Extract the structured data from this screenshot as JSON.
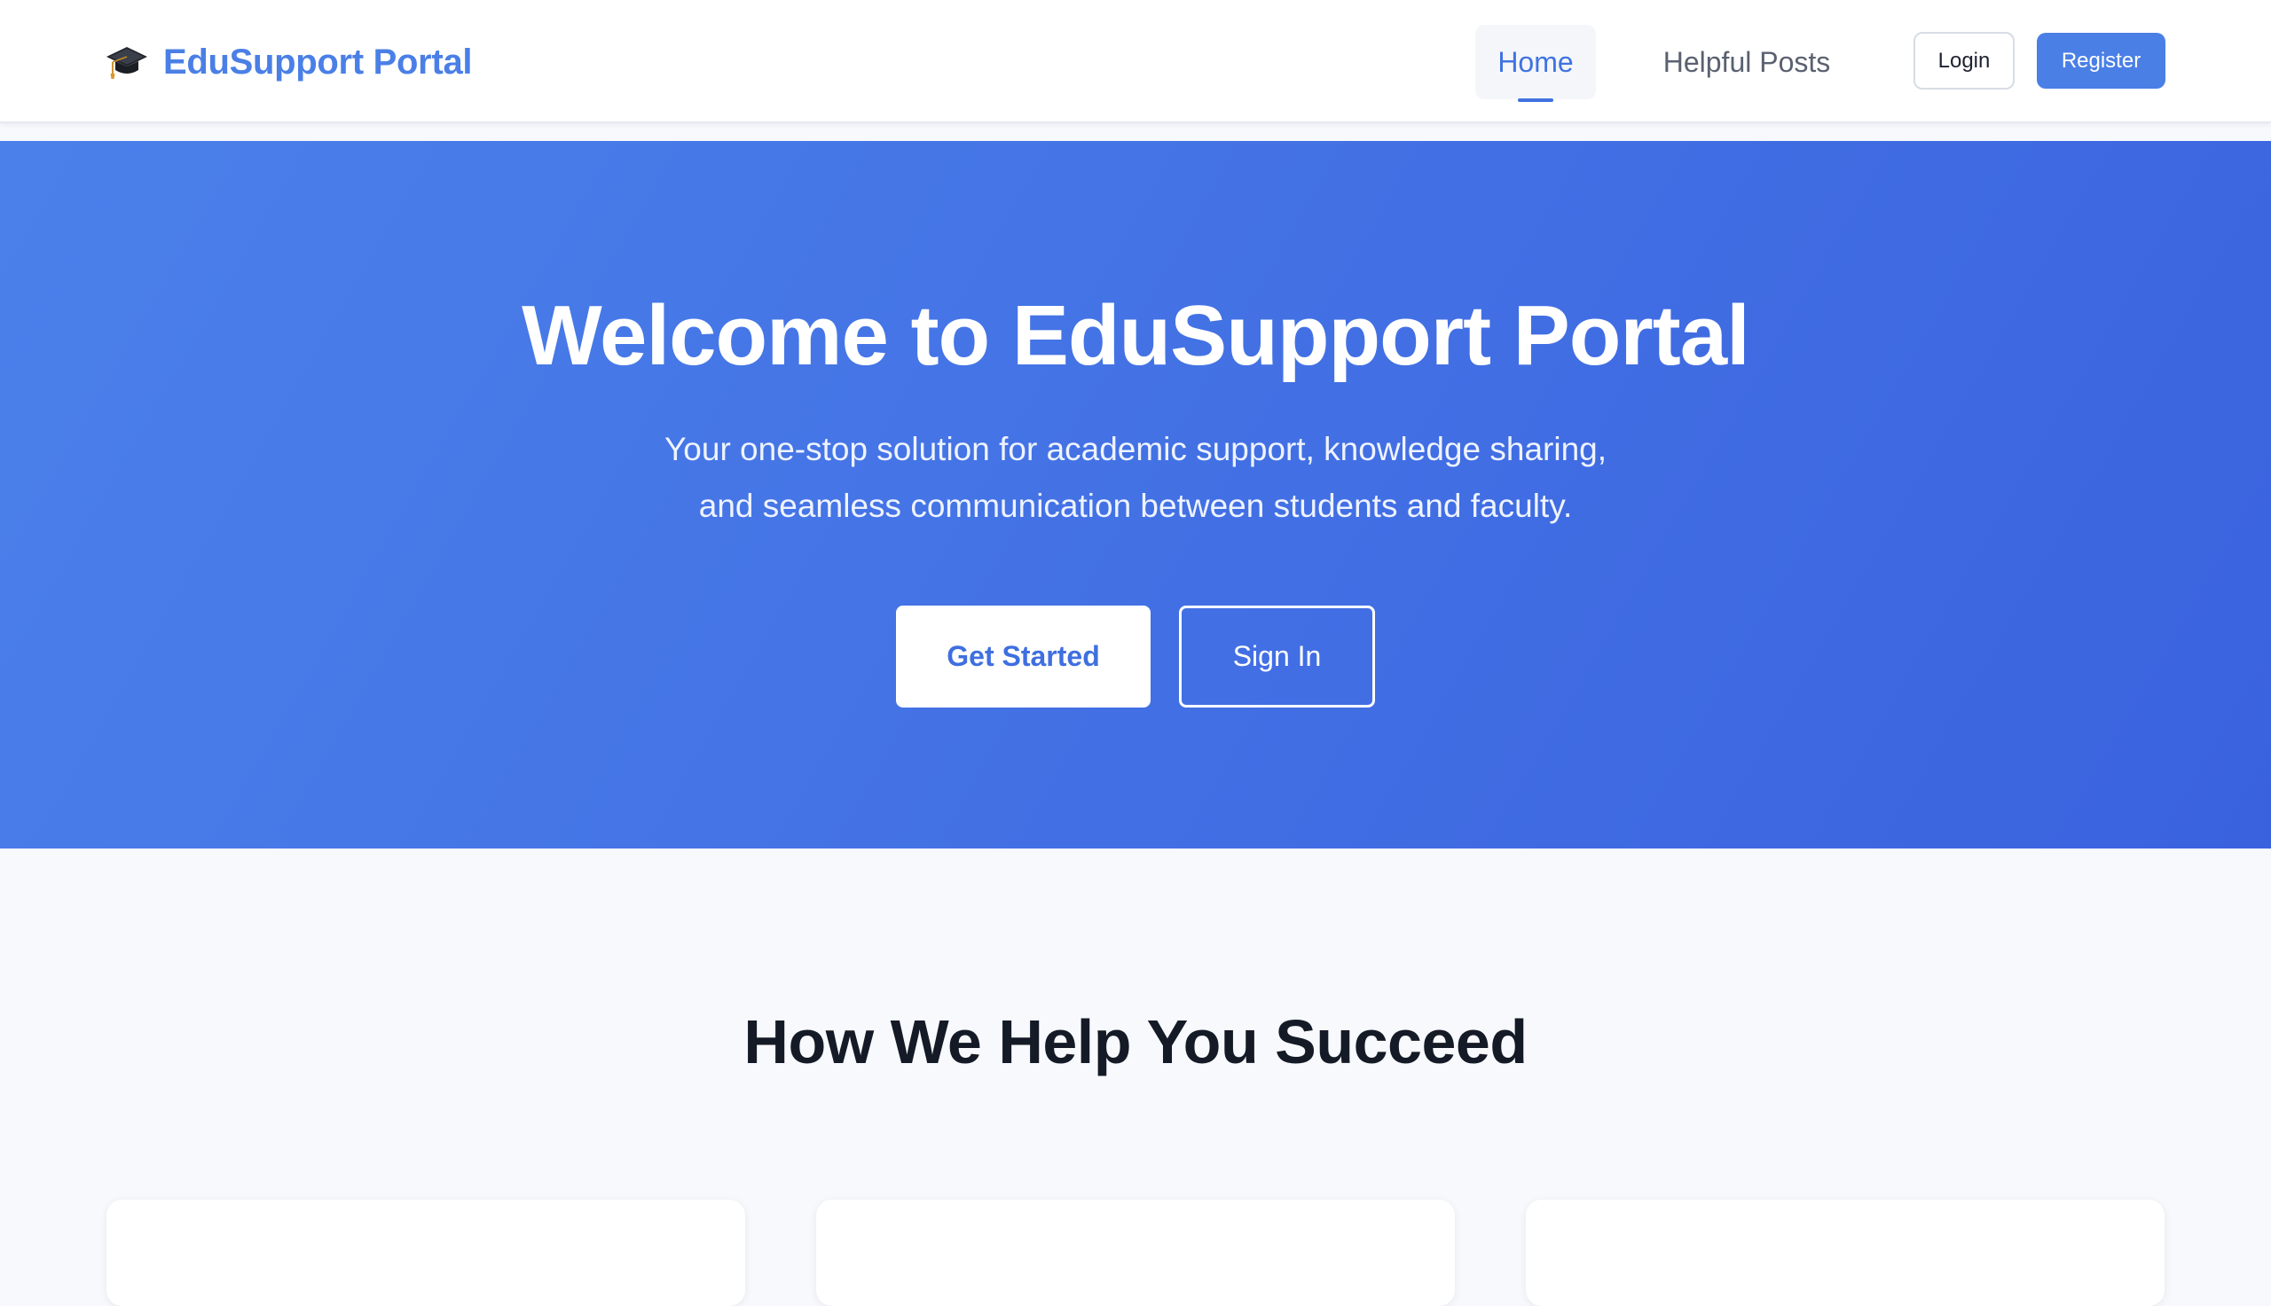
{
  "header": {
    "brand_icon": "graduation-cap-icon",
    "brand_name": "EduSupport Portal",
    "nav": [
      {
        "label": "Home",
        "active": true
      },
      {
        "label": "Helpful Posts",
        "active": false
      }
    ],
    "login_label": "Login",
    "register_label": "Register"
  },
  "hero": {
    "title": "Welcome to EduSupport Portal",
    "subtitle_line1": "Your one-stop solution for academic support, knowledge sharing,",
    "subtitle_line2": "and seamless communication between students and faculty.",
    "primary_cta": "Get Started",
    "secondary_cta": "Sign In"
  },
  "features": {
    "title": "How We Help You Succeed",
    "cards": [
      {},
      {},
      {}
    ]
  },
  "colors": {
    "brand": "#4a7fe6",
    "hero_gradient_start": "#4b80ea",
    "hero_gradient_end": "#3a62df",
    "page_background": "#f7f9fc",
    "heading_text": "#141a26"
  }
}
